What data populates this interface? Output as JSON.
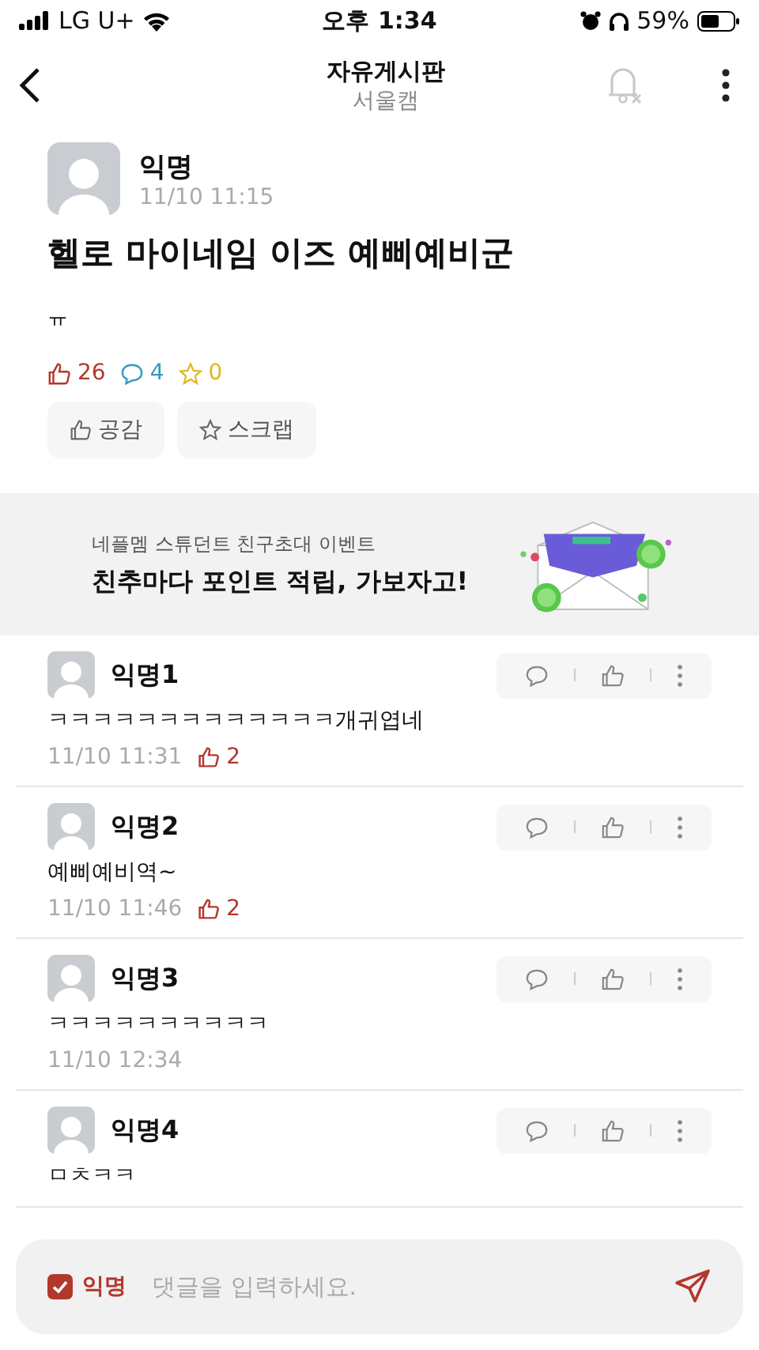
{
  "status_bar": {
    "carrier": "LG U+",
    "time": "오후 1:34",
    "battery": "59%"
  },
  "header": {
    "title": "자유게시판",
    "subtitle": "서울캠",
    "notifications_muted": true
  },
  "post": {
    "author": "익명",
    "time": "11/10 11:15",
    "title": "헬로 마이네임 이즈 예삐예비군",
    "body": "ㅠ",
    "likes": "26",
    "comments": "4",
    "scraps": "0",
    "buttons": [
      "공감",
      "스크랩"
    ]
  },
  "banner": {
    "caption": "네플멤 스튜던트 친구초대 이벤트",
    "headline": "친추마다 **포인트 적립**, 가보자고!",
    "kind": "picture"
  },
  "comments": [
    {
      "author": "익명1",
      "text": "ㅋㅋㅋㅋㅋㅋㅋㅋㅋㅋㅋㅋㅋ개귀엽네",
      "time": "11/10 11:31",
      "likes": "2"
    },
    {
      "author": "익명2",
      "text": "예삐예비역~",
      "time": "11/10 11:46",
      "likes": "2"
    },
    {
      "author": "익명3",
      "text": "ㅋㅋㅋㅋㅋㅋㅋㅋㅋㅋ",
      "time": "11/10 12:34"
    },
    {
      "author": "익명4",
      "text": "ㅁㅊㅋㅋ"
    }
  ],
  "composer": {
    "anonymous_label": "익명",
    "anonymous": {
      "checked": true
    },
    "placeholder": "댓글을 입력하세요."
  }
}
